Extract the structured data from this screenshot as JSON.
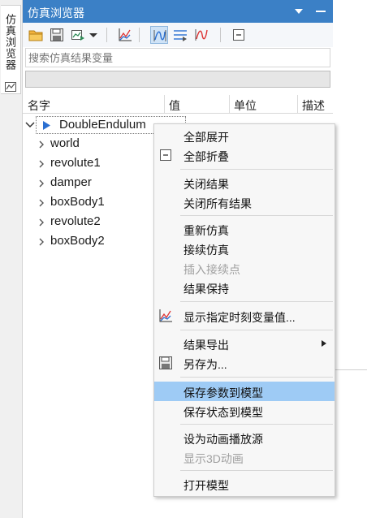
{
  "side_tab": {
    "label": "仿真浏览器",
    "icon": "chart-icon"
  },
  "title_bar": {
    "title": "仿真浏览器",
    "buttons": [
      "dropdown-icon",
      "minimize-icon"
    ]
  },
  "toolbar": {
    "tools": [
      "open-folder-icon",
      "save-icon",
      "export-icon",
      "dropdown-arrow-icon",
      "plot-icon",
      "curve-icon",
      "list-curve-icon",
      "red-curve-icon",
      "collapse-icon"
    ]
  },
  "search": {
    "placeholder": "搜索仿真结果变量"
  },
  "table": {
    "columns": [
      "名字",
      "值",
      "单位",
      "描述"
    ],
    "root": "DoubleEndulum",
    "children": [
      "world",
      "revolute1",
      "damper",
      "boxBody1",
      "revolute2",
      "boxBody2"
    ]
  },
  "context_menu": {
    "items": [
      {
        "label": "全部展开",
        "disabled": false,
        "icon": ""
      },
      {
        "label": "全部折叠",
        "disabled": false,
        "icon": "collapse-icon"
      },
      {
        "label": "关闭结果",
        "disabled": false,
        "icon": ""
      },
      {
        "label": "关闭所有结果",
        "disabled": false,
        "icon": ""
      },
      {
        "label": "重新仿真",
        "disabled": false,
        "icon": ""
      },
      {
        "label": "接续仿真",
        "disabled": false,
        "icon": ""
      },
      {
        "label": "插入接续点",
        "disabled": true,
        "icon": ""
      },
      {
        "label": "结果保持",
        "disabled": false,
        "icon": ""
      },
      {
        "label": "显示指定时刻变量值...",
        "disabled": false,
        "icon": "plot-icon"
      },
      {
        "label": "结果导出",
        "disabled": false,
        "icon": "",
        "submenu": true
      },
      {
        "label": "另存为...",
        "disabled": false,
        "icon": "save-icon"
      },
      {
        "label": "保存参数到模型",
        "disabled": false,
        "icon": "",
        "highlighted": true
      },
      {
        "label": "保存状态到模型",
        "disabled": false,
        "icon": ""
      },
      {
        "label": "设为动画播放源",
        "disabled": false,
        "icon": ""
      },
      {
        "label": "显示3D动画",
        "disabled": true,
        "icon": ""
      },
      {
        "label": "打开模型",
        "disabled": false,
        "icon": ""
      }
    ]
  }
}
